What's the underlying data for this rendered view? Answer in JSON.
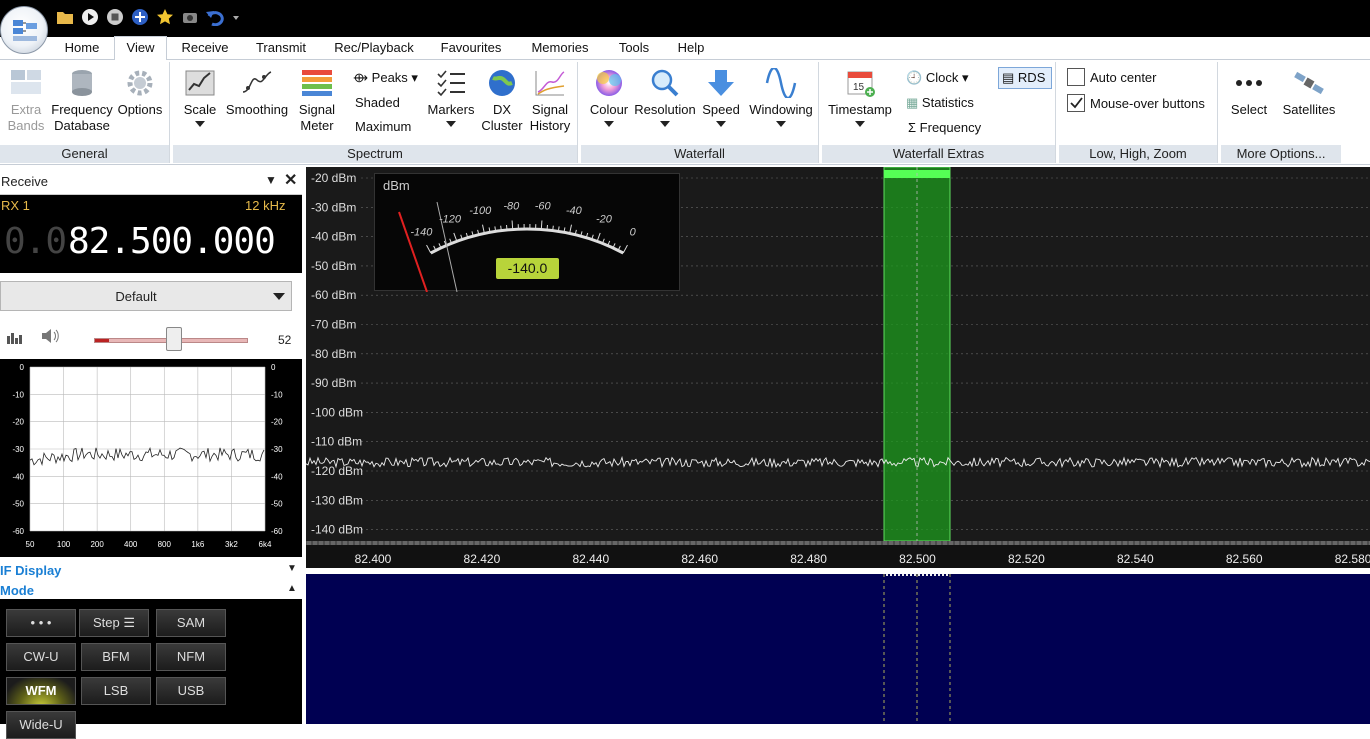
{
  "tabs": [
    "Home",
    "View",
    "Receive",
    "Transmit",
    "Rec/Playback",
    "Favourites",
    "Memories",
    "Tools",
    "Help"
  ],
  "active_tab": "View",
  "ribbon": {
    "general": {
      "caption": "General",
      "extra_bands": "Extra Bands",
      "frequency_database": "Frequency Database",
      "options": "Options"
    },
    "spectrum": {
      "caption": "Spectrum",
      "scale": "Scale",
      "smoothing": "Smoothing",
      "signal_meter": "Signal Meter",
      "peaks": "Peaks",
      "shaded": "Shaded",
      "maximum": "Maximum",
      "markers": "Markers",
      "dx_cluster": "DX Cluster",
      "signal_history": "Signal History"
    },
    "waterfall": {
      "caption": "Waterfall",
      "colour": "Colour",
      "resolution": "Resolution",
      "speed": "Speed",
      "windowing": "Windowing"
    },
    "waterfall_extras": {
      "caption": "Waterfall Extras",
      "timestamp": "Timestamp",
      "clock": "Clock",
      "statistics": "Statistics",
      "frequency": "Frequency",
      "rds": "RDS"
    },
    "lhz": {
      "caption": "Low, High, Zoom",
      "auto_center": "Auto center",
      "mouse_over": "Mouse-over buttons",
      "auto_center_checked": false,
      "mouse_over_checked": true
    },
    "more": {
      "caption": "More Options...",
      "select": "Select",
      "satellites": "Satellites"
    }
  },
  "receive_panel": {
    "title": "Receive",
    "rx": "RX 1",
    "bandwidth": "12 kHz",
    "freq_dim": "0.0",
    "freq_main": "82.500.000",
    "preset": "Default",
    "volume": "52",
    "volume_level": 0.52
  },
  "if_display": {
    "title": "IF Display",
    "y_labels": [
      "0",
      "-10",
      "-20",
      "-30",
      "-40",
      "-50",
      "-60"
    ],
    "x_labels": [
      "50",
      "100",
      "200",
      "400",
      "800",
      "1k6",
      "3k2",
      "6k4"
    ]
  },
  "mode_panel": {
    "title": "Mode",
    "buttons": [
      [
        "• • •",
        "Step ☰",
        "SAM"
      ],
      [
        "CW-U",
        "BFM",
        "NFM"
      ],
      [
        "WFM",
        "LSB",
        "USB"
      ],
      [
        "Wide-U"
      ]
    ],
    "selected": "WFM"
  },
  "meter": {
    "unit": "dBm",
    "scale": [
      "-140",
      "-120",
      "-100",
      "-80",
      "-60",
      "-40",
      "-20",
      "0"
    ],
    "value": "-140.0"
  },
  "spectrum": {
    "y_labels": [
      "-20 dBm",
      "-30 dBm",
      "-40 dBm",
      "-50 dBm",
      "-60 dBm",
      "-70 dBm",
      "-80 dBm",
      "-90 dBm",
      "-100 dBm",
      "-110 dBm",
      "-120 dBm",
      "-130 dBm",
      "-140 dBm"
    ],
    "x_labels": [
      "82.400",
      "82.420",
      "82.440",
      "82.460",
      "82.480",
      "82.500",
      "82.520",
      "82.540",
      "82.560",
      "82.580"
    ],
    "noise_floor_dbm": -117
  },
  "colors": {
    "accent": "#1a7fd4",
    "filter": "#2eb82e",
    "meter_value_bg": "#b8d43a",
    "waterfall": "#000052"
  }
}
